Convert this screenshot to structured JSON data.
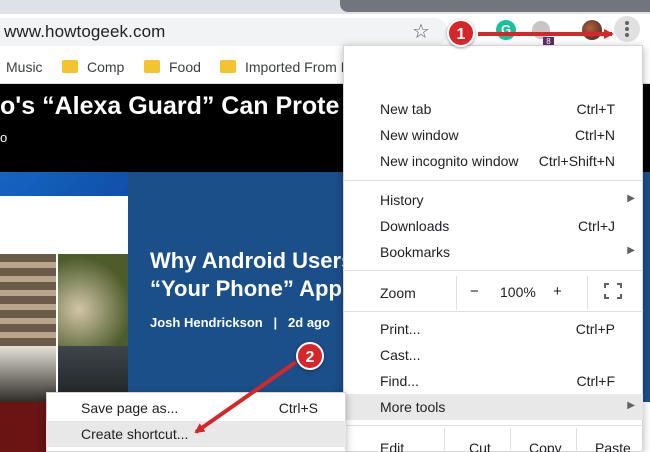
{
  "browser": {
    "url": "www.howtogeek.com",
    "grammarly_letter": "G",
    "ext_badge_label": "8"
  },
  "bookmarks": [
    "Music",
    "Comp",
    "Food",
    "Imported From F"
  ],
  "article": {
    "headline": "o's “Alexa Guard” Can Prote",
    "headline_sub": "o"
  },
  "hero": {
    "title_line1": "Why Android Users",
    "title_line2": "“Your Phone” App",
    "author": "Josh Hendrickson",
    "separator": "|",
    "age": "2d ago"
  },
  "menu": {
    "new_tab": {
      "label": "New tab",
      "shortcut": "Ctrl+T"
    },
    "new_window": {
      "label": "New window",
      "shortcut": "Ctrl+N"
    },
    "new_incognito": {
      "label": "New incognito window",
      "shortcut": "Ctrl+Shift+N"
    },
    "history": {
      "label": "History"
    },
    "downloads": {
      "label": "Downloads",
      "shortcut": "Ctrl+J"
    },
    "bookmarks": {
      "label": "Bookmarks"
    },
    "zoom": {
      "label": "Zoom",
      "minus": "−",
      "value": "100%",
      "plus": "+"
    },
    "print": {
      "label": "Print...",
      "shortcut": "Ctrl+P"
    },
    "cast": {
      "label": "Cast..."
    },
    "find": {
      "label": "Find...",
      "shortcut": "Ctrl+F"
    },
    "more_tools": {
      "label": "More tools"
    },
    "edit": {
      "label": "Edit",
      "cut": "Cut",
      "copy": "Copy",
      "paste": "Paste"
    }
  },
  "submenu": {
    "save_page": {
      "label": "Save page as...",
      "shortcut": "Ctrl+S"
    },
    "create_shortcut": {
      "label": "Create shortcut..."
    }
  },
  "annotations": {
    "step1": "1",
    "step2": "2",
    "accent": "#d6262a"
  }
}
